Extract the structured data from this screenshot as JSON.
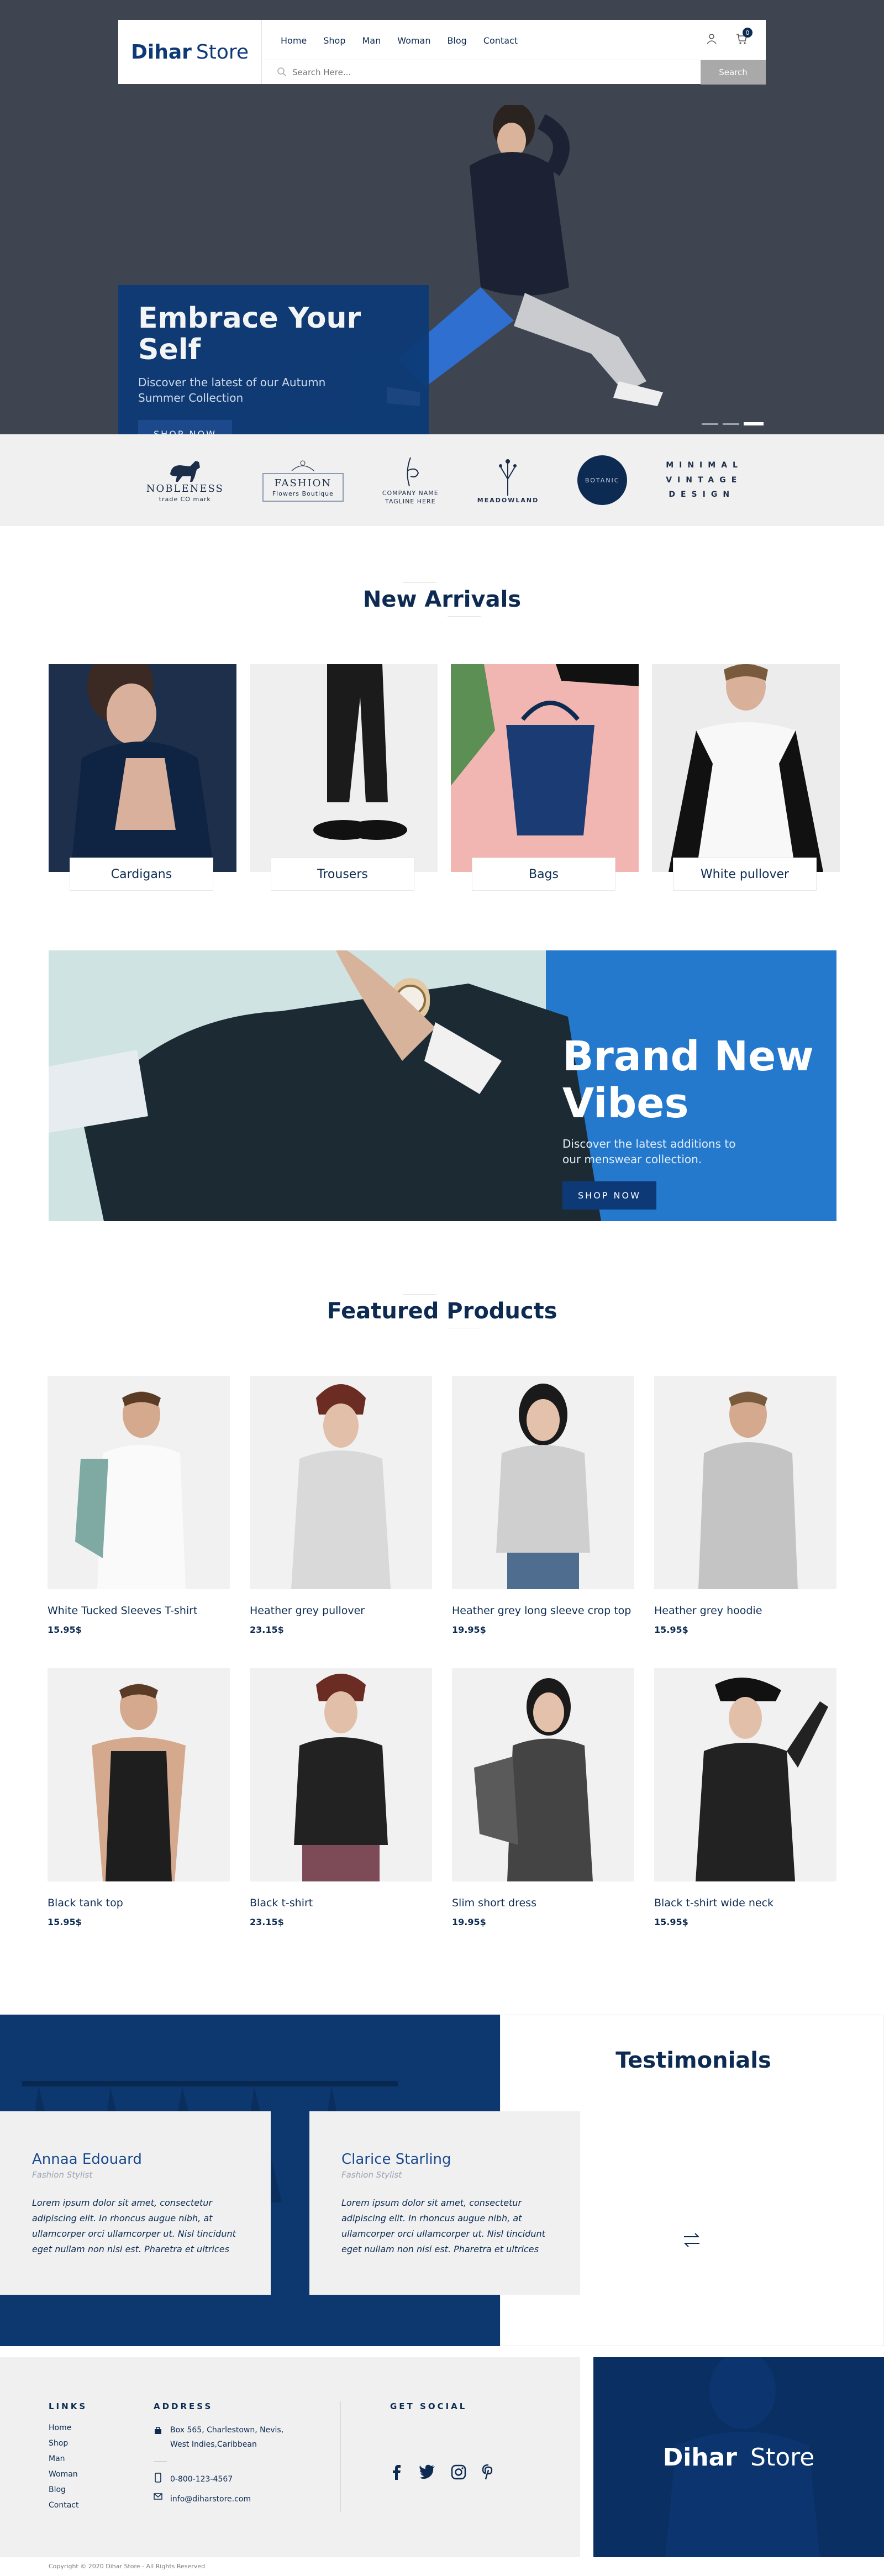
{
  "header": {
    "brand_bold": "Dihar",
    "brand_rest": "Store",
    "nav": [
      "Home",
      "Shop",
      "Man",
      "Woman",
      "Blog",
      "Contact"
    ],
    "cart_count": "0",
    "search_placeholder": "Search Here...",
    "search_button": "Search"
  },
  "hero": {
    "title": "Embrace Your Self",
    "subtitle": "Discover the latest of our Autumn Summer Collection",
    "button": "SHOP NOW",
    "slides": 3,
    "active_slide": 3
  },
  "brands": [
    {
      "name": "NOBLENESS",
      "sub": "trade CO mark",
      "icon": "dog-icon"
    },
    {
      "name": "FASHION",
      "sub": "Flowers Boutique",
      "icon": "flower-icon"
    },
    {
      "name": "COMPANY NAME",
      "sub": "TAGLINE HERE",
      "icon": "signature-icon"
    },
    {
      "name": "MEADOWLAND",
      "sub": "",
      "icon": "lavender-icon"
    },
    {
      "name": "BOTANIC",
      "sub": "",
      "icon": "circle-badge-icon"
    },
    {
      "name": "MINIMAL VINTAGE DESIGN",
      "sub": "",
      "icon": "text-logo"
    }
  ],
  "arrivals": {
    "title": "New Arrivals",
    "items": [
      "Cardigans",
      "Trousers",
      "Bags",
      "White pullover"
    ]
  },
  "banner": {
    "title_line1": "Brand New",
    "title_line2": "Vibes",
    "subtitle": "Discover the latest additions to our menswear collection.",
    "button": "SHOP NOW"
  },
  "featured": {
    "title": "Featured Products",
    "products": [
      {
        "name": "White Tucked Sleeves T-shirt",
        "price": "15.95$"
      },
      {
        "name": "Heather grey pullover",
        "price": "23.15$"
      },
      {
        "name": "Heather grey long sleeve crop top",
        "price": "19.95$"
      },
      {
        "name": "Heather grey hoodie",
        "price": "15.95$"
      },
      {
        "name": "Black tank top",
        "price": "15.95$"
      },
      {
        "name": "Black t-shirt",
        "price": "23.15$"
      },
      {
        "name": "Slim short dress",
        "price": "19.95$"
      },
      {
        "name": "Black t-shirt wide neck",
        "price": "15.95$"
      }
    ]
  },
  "testimonials": {
    "title": "Testimonials",
    "items": [
      {
        "name": "Annaa Edouard",
        "role": "Fashion Stylist",
        "quote": "Lorem ipsum dolor sit amet, consectetur adipiscing elit. In rhoncus augue nibh, at ullamcorper orci ullamcorper ut. Nisl tincidunt eget nullam non nisi est. Pharetra et ultrices"
      },
      {
        "name": "Clarice Starling",
        "role": "Fashion Stylist",
        "quote": "Lorem ipsum dolor sit amet, consectetur adipiscing elit. In rhoncus augue nibh, at ullamcorper orci ullamcorper ut. Nisl tincidunt eget nullam non nisi est. Pharetra et ultrices"
      }
    ]
  },
  "footer": {
    "links_head": "LINKS",
    "links": [
      "Home",
      "Shop",
      "Man",
      "Woman",
      "Blog",
      "Contact"
    ],
    "address_head": "ADDRESS",
    "address_line1": "Box 565, Charlestown, Nevis,",
    "address_line2": "West Indies,Caribbean",
    "phone": "0-800-123-4567",
    "email": "info@diharstore.com",
    "social_head": "GET SOCIAL",
    "socials": [
      "facebook-icon",
      "twitter-icon",
      "instagram-icon",
      "pinterest-icon"
    ],
    "brand_bold": "Dihar",
    "brand_rest": "Store",
    "copyright": "Copyright © 2020 Dihar Store - All Rights Reserved"
  },
  "colors": {
    "primary": "#0d3a77",
    "dark": "#0d2b52",
    "hero_bg": "#3e4550",
    "light_bg": "#f0f0f0",
    "banner_blue": "#1f74c7"
  }
}
